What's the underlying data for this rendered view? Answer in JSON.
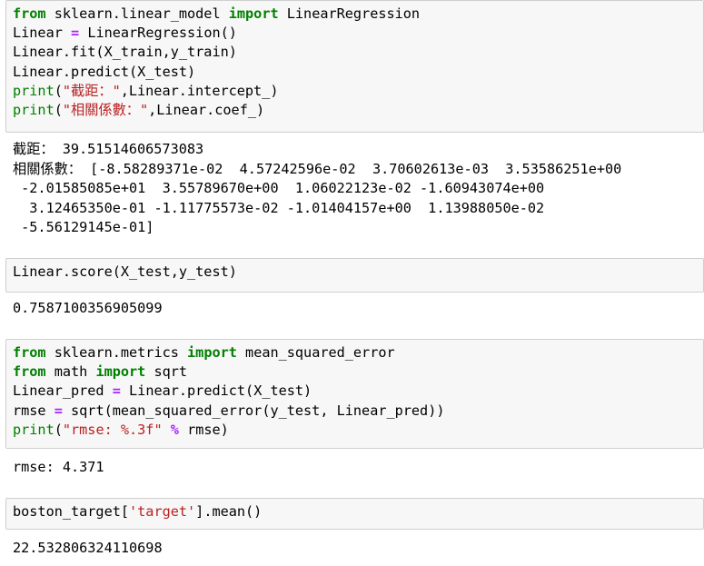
{
  "cells": [
    {
      "input": [
        [
          {
            "t": "from",
            "c": "kw"
          },
          {
            "t": " sklearn.linear_model "
          },
          {
            "t": "import",
            "c": "kw"
          },
          {
            "t": " LinearRegression"
          }
        ],
        [
          {
            "t": "Linear "
          },
          {
            "t": "=",
            "c": "op"
          },
          {
            "t": " LinearRegression()"
          }
        ],
        [
          {
            "t": "Linear.fit(X_train,y_train)"
          }
        ],
        [
          {
            "t": "Linear.predict(X_test)"
          }
        ],
        [
          {
            "t": "print",
            "c": "bi"
          },
          {
            "t": "("
          },
          {
            "t": "\"截距：\"",
            "c": "str"
          },
          {
            "t": ",Linear.intercept_)"
          }
        ],
        [
          {
            "t": "print",
            "c": "bi"
          },
          {
            "t": "("
          },
          {
            "t": "\"相關係數：\"",
            "c": "str"
          },
          {
            "t": ",Linear.coef_)"
          }
        ]
      ],
      "output": [
        "截距： 39.51514606573083",
        "相關係數： [-8.58289371e-02  4.57242596e-02  3.70602613e-03  3.53586251e+00",
        " -2.01585085e+01  3.55789670e+00  1.06022123e-02 -1.60943074e+00",
        "  3.12465350e-01 -1.11775573e-02 -1.01404157e+00  1.13988050e-02",
        " -5.56129145e-01]"
      ]
    },
    {
      "input": [
        [
          {
            "t": "Linear.score(X_test,y_test)"
          }
        ]
      ],
      "output": [
        "0.7587100356905099"
      ]
    },
    {
      "input": [
        [
          {
            "t": "from",
            "c": "kw"
          },
          {
            "t": " sklearn.metrics "
          },
          {
            "t": "import",
            "c": "kw"
          },
          {
            "t": " mean_squared_error"
          }
        ],
        [
          {
            "t": "from",
            "c": "kw"
          },
          {
            "t": " math "
          },
          {
            "t": "import",
            "c": "kw"
          },
          {
            "t": " sqrt"
          }
        ],
        [
          {
            "t": "Linear_pred "
          },
          {
            "t": "=",
            "c": "op"
          },
          {
            "t": " Linear.predict(X_test)"
          }
        ],
        [
          {
            "t": "rmse "
          },
          {
            "t": "=",
            "c": "op"
          },
          {
            "t": " sqrt(mean_squared_error(y_test, Linear_pred))"
          }
        ],
        [
          {
            "t": "print",
            "c": "bi"
          },
          {
            "t": "("
          },
          {
            "t": "\"rmse: %.3f\"",
            "c": "str"
          },
          {
            "t": " "
          },
          {
            "t": "%",
            "c": "op"
          },
          {
            "t": " rmse)"
          }
        ]
      ],
      "output": [
        "rmse: 4.371"
      ]
    },
    {
      "input": [
        [
          {
            "t": "boston_target["
          },
          {
            "t": "'target'",
            "c": "str"
          },
          {
            "t": "].mean()"
          }
        ]
      ],
      "output": [
        "22.532806324110698"
      ]
    }
  ],
  "colors": {
    "keyword": "#008000",
    "operator": "#aa22ff",
    "string": "#ba2121",
    "cell_background": "#f7f7f7",
    "cell_border": "#cfcfcf"
  }
}
